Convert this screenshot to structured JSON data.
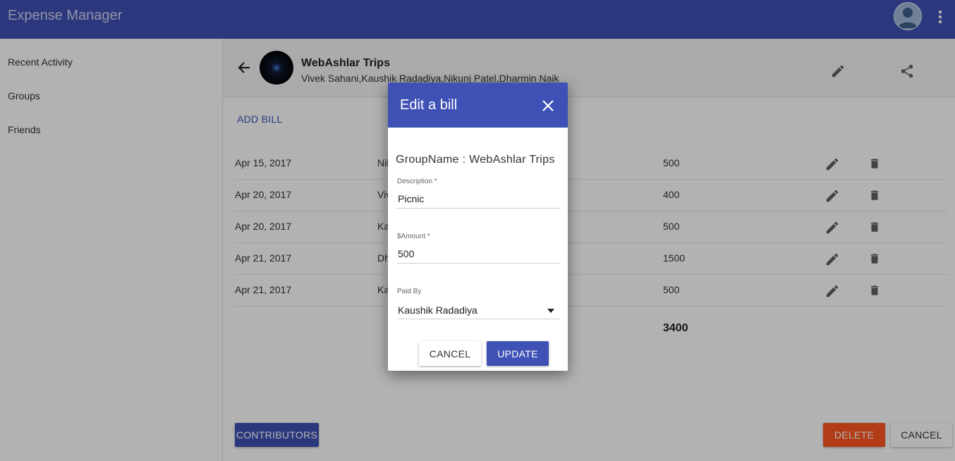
{
  "app": {
    "title": "Expense Manager"
  },
  "sidebar": {
    "items": [
      {
        "label": "Recent Activity"
      },
      {
        "label": "Groups"
      },
      {
        "label": "Friends"
      }
    ]
  },
  "group": {
    "name": "WebAshlar Trips",
    "members": "Vivek Sahani,Kaushik Radadiya,Nikunj Patel,Dharmin Naik"
  },
  "actions": {
    "add_bill": "ADD BILL"
  },
  "bills": [
    {
      "date": "Apr 15, 2017",
      "payer": "Nil",
      "amount": "500"
    },
    {
      "date": "Apr 20, 2017",
      "payer": "Viv",
      "amount": "400"
    },
    {
      "date": "Apr 20, 2017",
      "payer": "Ka",
      "amount": "500"
    },
    {
      "date": "Apr 21, 2017",
      "payer": "Dh",
      "amount": "1500"
    },
    {
      "date": "Apr 21, 2017",
      "payer": "Ka",
      "amount": "500"
    }
  ],
  "total": "3400",
  "footer": {
    "contributors": "CONTRIBUTORS",
    "delete": "DELETE",
    "cancel": "CANCEL"
  },
  "dialog": {
    "title": "Edit a bill",
    "group_line": "GroupName : WebAshlar Trips",
    "description": {
      "label": "Description *",
      "value": "Picnic"
    },
    "amount": {
      "label": "$Amount *",
      "value": "500"
    },
    "paid_by": {
      "label": "Paid By",
      "value": "Kaushik Radadiya"
    },
    "cancel": "CANCEL",
    "update": "UPDATE"
  },
  "colors": {
    "primary": "#3f51b5",
    "accent": "#ff5722"
  },
  "icons": [
    "account-circle-icon",
    "more-vert-icon",
    "arrow-back-icon",
    "pencil-icon",
    "share-icon",
    "delete-icon",
    "close-icon",
    "dropdown-caret-icon"
  ]
}
